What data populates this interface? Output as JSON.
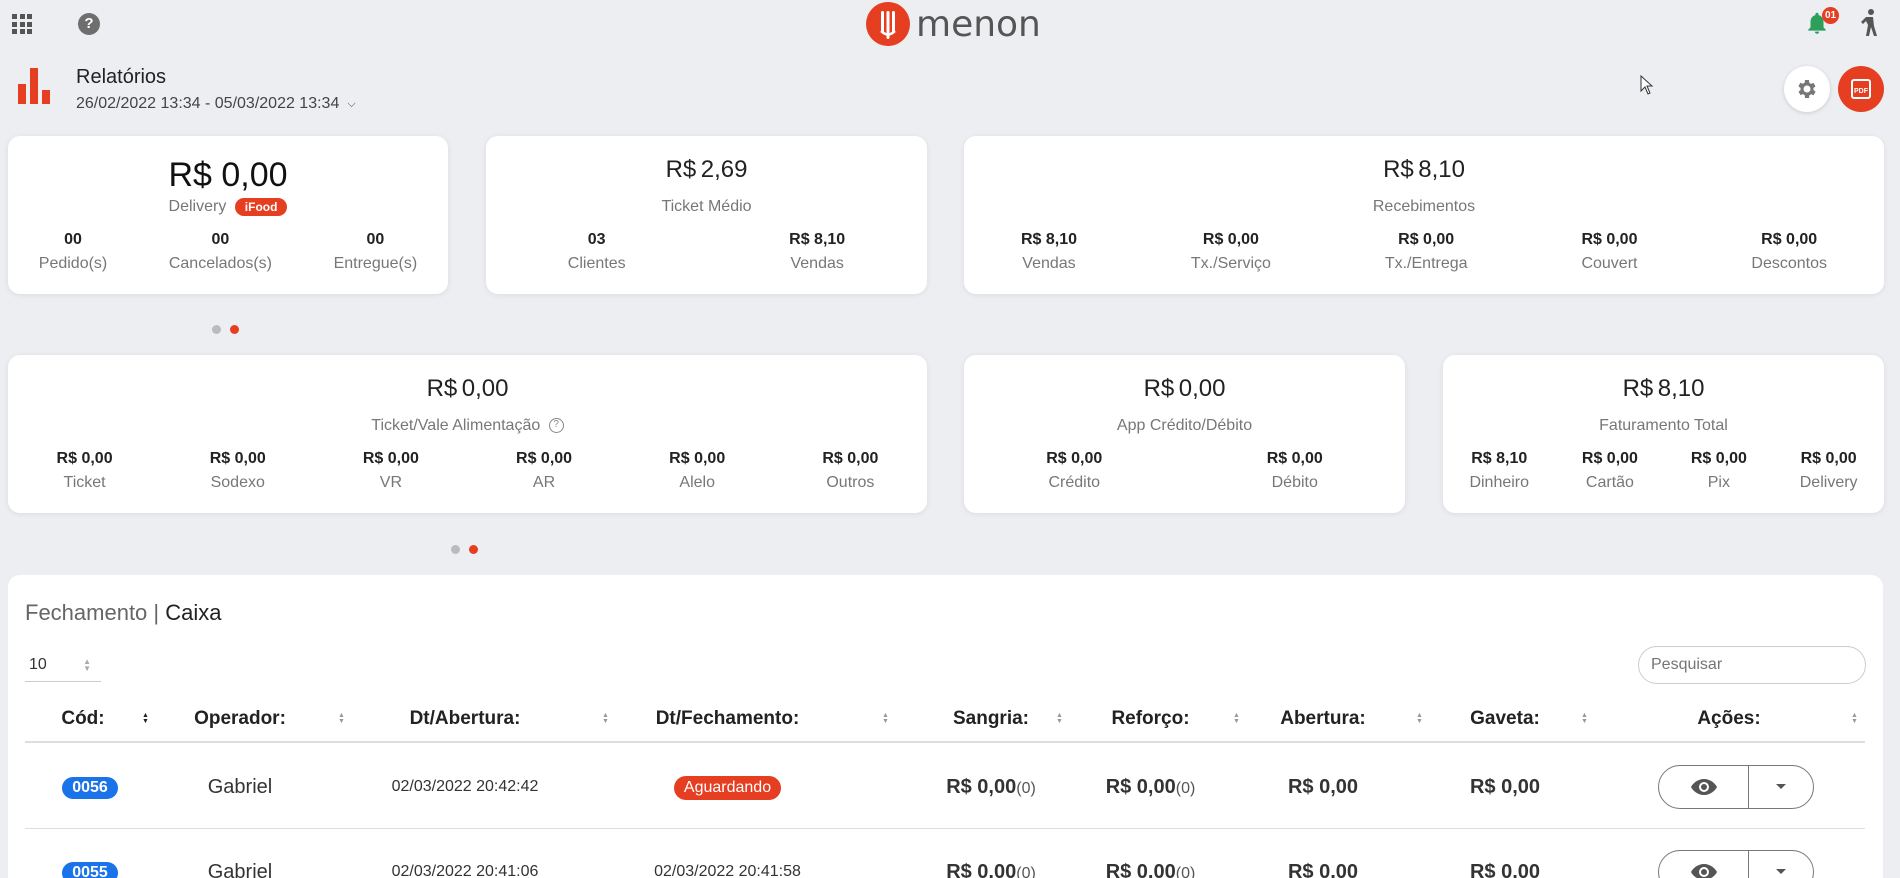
{
  "brand": {
    "name": "menon",
    "color": "#e53e21"
  },
  "header": {
    "notification_count": "01",
    "report_title": "Relatórios",
    "date_range": "26/02/2022 13:34 - 05/03/2022 13:34"
  },
  "delivery_card": {
    "amount": "R$ 0,00",
    "label": "Delivery",
    "badge": "iFood",
    "items": [
      {
        "value": "00",
        "label": "Pedido(s)"
      },
      {
        "value": "00",
        "label": "Cancelados(s)"
      },
      {
        "value": "00",
        "label": "Entregue(s)"
      }
    ]
  },
  "ticket_card": {
    "currency": "R$",
    "int": "2",
    "dec": ",69",
    "label": "Ticket Médio",
    "items": [
      {
        "value": "03",
        "label": "Clientes"
      },
      {
        "value": "R$ 8,10",
        "label": "Vendas"
      }
    ]
  },
  "receipts_card": {
    "currency": "R$",
    "int": "8",
    "dec": ",10",
    "label": "Recebimentos",
    "items": [
      {
        "value": "R$ 8,10",
        "label": "Vendas"
      },
      {
        "value": "R$ 0,00",
        "label": "Tx./Serviço"
      },
      {
        "value": "R$ 0,00",
        "label": "Tx./Entrega"
      },
      {
        "value": "R$ 0,00",
        "label": "Couvert"
      },
      {
        "value": "R$ 0,00",
        "label": "Descontos"
      }
    ]
  },
  "voucher_card": {
    "currency": "R$",
    "int": "0",
    "dec": ",00",
    "label": "Ticket/Vale Alimentação",
    "items": [
      {
        "value": "R$ 0,00",
        "label": "Ticket"
      },
      {
        "value": "R$ 0,00",
        "label": "Sodexo"
      },
      {
        "value": "R$ 0,00",
        "label": "VR"
      },
      {
        "value": "R$ 0,00",
        "label": "AR"
      },
      {
        "value": "R$ 0,00",
        "label": "Alelo"
      },
      {
        "value": "R$ 0,00",
        "label": "Outros"
      }
    ]
  },
  "app_card": {
    "currency": "R$",
    "int": "0",
    "dec": ",00",
    "label": "App Crédito/Débito",
    "items": [
      {
        "value": "R$ 0,00",
        "label": "Crédito"
      },
      {
        "value": "R$ 0,00",
        "label": "Débito"
      }
    ]
  },
  "revenue_card": {
    "currency": "R$",
    "int": "8",
    "dec": ",10",
    "label": "Faturamento Total",
    "items": [
      {
        "value": "R$ 8,10",
        "label": "Dinheiro"
      },
      {
        "value": "R$ 0,00",
        "label": "Cartão"
      },
      {
        "value": "R$ 0,00",
        "label": "Pix"
      },
      {
        "value": "R$ 0,00",
        "label": "Delivery"
      }
    ]
  },
  "table": {
    "title_prefix": "Fechamento | ",
    "title_bold": "Caixa",
    "page_size": "10",
    "search_placeholder": "Pesquisar",
    "columns": [
      "Cód:",
      "Operador:",
      "Dt/Abertura:",
      "Dt/Fechamento:",
      "Sangria:",
      "Reforço:",
      "Abertura:",
      "Gaveta:",
      "Ações:"
    ],
    "rows": [
      {
        "code": "0056",
        "operator": "Gabriel",
        "opened": "02/03/2022 20:42:42",
        "closed": "Aguardando",
        "closed_is_badge": true,
        "sangria": "R$ 0,00",
        "sangria_count": "(0)",
        "reforco": "R$ 0,00",
        "reforco_count": "(0)",
        "abertura": "R$ 0,00",
        "gaveta": "R$ 0,00"
      },
      {
        "code": "0055",
        "operator": "Gabriel",
        "opened": "02/03/2022 20:41:06",
        "closed": "02/03/2022 20:41:58",
        "closed_is_badge": false,
        "sangria": "R$ 0,00",
        "sangria_count": "(0)",
        "reforco": "R$ 0,00",
        "reforco_count": "(0)",
        "abertura": "R$ 0,00",
        "gaveta": "R$ 0,00"
      }
    ]
  }
}
